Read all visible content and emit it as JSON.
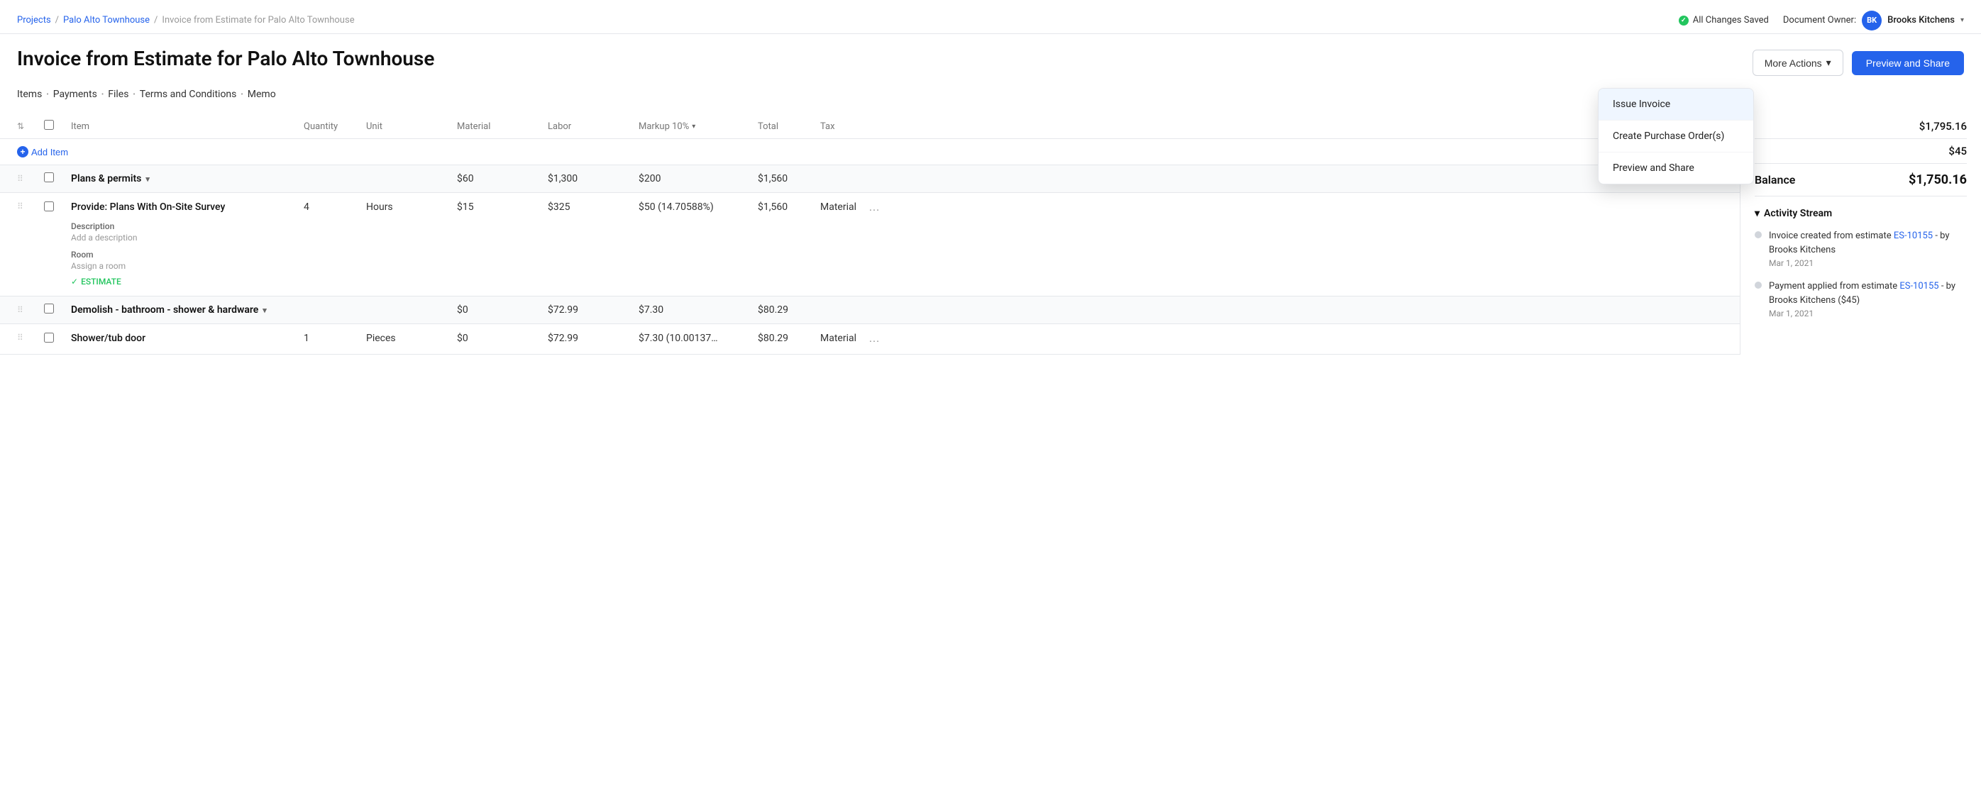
{
  "breadcrumb": {
    "projects_label": "Projects",
    "project_name": "Palo Alto Townhouse",
    "page_name": "Invoice from Estimate for Palo Alto Townhouse"
  },
  "header": {
    "all_saved_label": "All Changes Saved",
    "doc_owner_label": "Document Owner:",
    "owner_initials": "BK",
    "owner_name": "Brooks Kitchens",
    "page_title": "Invoice from Estimate for Palo Alto Townhouse",
    "more_actions_label": "More Actions",
    "preview_share_label": "Preview and Share"
  },
  "nav_tabs": {
    "items_label": "Items",
    "payments_label": "Payments",
    "files_label": "Files",
    "terms_label": "Terms and Conditions",
    "memo_label": "Memo"
  },
  "table": {
    "col_item": "Item",
    "col_quantity": "Quantity",
    "col_unit": "Unit",
    "col_material": "Material",
    "col_labor": "Labor",
    "col_markup": "Markup 10%",
    "col_total": "Total",
    "col_tax": "Tax",
    "add_item_label": "Add Item",
    "groups": [
      {
        "id": "group-1",
        "name": "Plans & permits",
        "material": "$60",
        "labor": "$1,300",
        "markup": "$200",
        "total": "$1,560",
        "items": [
          {
            "id": "item-1",
            "name": "Provide: Plans With On-Site Survey",
            "quantity": "4",
            "unit": "Hours",
            "material": "$15",
            "labor": "$325",
            "markup": "$50 (14.70588%)",
            "total": "$1,560",
            "tax_type": "Material",
            "description_label": "Description",
            "description_placeholder": "Add a description",
            "room_label": "Room",
            "room_placeholder": "Assign a room",
            "badge_label": "ESTIMATE"
          }
        ]
      },
      {
        "id": "group-2",
        "name": "Demolish - bathroom - shower & hardware",
        "material": "$0",
        "labor": "$72.99",
        "markup": "$7.30",
        "total": "$80.29",
        "items": [
          {
            "id": "item-2",
            "name": "Shower/tub door",
            "quantity": "1",
            "unit": "Pieces",
            "material": "$0",
            "labor": "$72.99",
            "markup": "$7.30 (10.00137…",
            "total": "$80.29",
            "tax_type": "Material"
          }
        ]
      }
    ]
  },
  "sidebar": {
    "amount_label": "",
    "amount_value": "$1,795.16",
    "payments_label": "",
    "payments_value": "$45",
    "balance_label": "Balance",
    "balance_value": "$1,750.16",
    "activity_header": "Activity Stream",
    "activities": [
      {
        "text_before": "Invoice created from estimate ",
        "link_text": "ES-10155",
        "text_after": " - by Brooks Kitchens",
        "date": "Mar 1, 2021"
      },
      {
        "text_before": "Payment applied from estimate ",
        "link_text": "ES-10155",
        "text_after": " - by Brooks Kitchens ($45)",
        "date": "Mar 1, 2021"
      }
    ]
  },
  "dropdown": {
    "items": [
      {
        "label": "Issue Invoice",
        "id": "issue-invoice"
      },
      {
        "label": "Create Purchase Order(s)",
        "id": "create-po"
      },
      {
        "label": "Preview and Share",
        "id": "preview-share-menu"
      }
    ]
  }
}
